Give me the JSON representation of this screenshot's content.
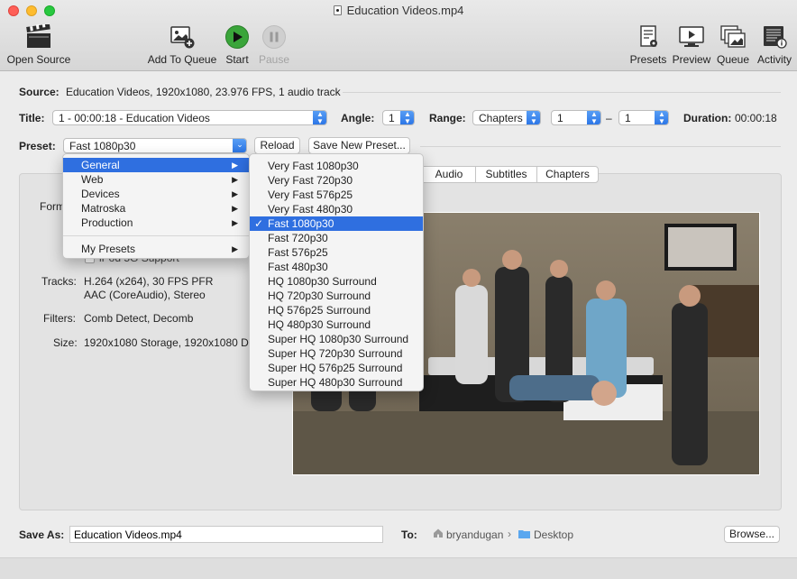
{
  "window": {
    "title": "Education Videos.mp4"
  },
  "toolbar": {
    "open_source": "Open Source",
    "add_to_queue": "Add To Queue",
    "start": "Start",
    "pause": "Pause",
    "presets": "Presets",
    "preview": "Preview",
    "queue": "Queue",
    "activity": "Activity"
  },
  "source": {
    "label": "Source:",
    "value": "Education Videos, 1920x1080, 23.976 FPS, 1 audio track"
  },
  "title_row": {
    "title_label": "Title:",
    "title_value": "1 - 00:00:18 - Education Videos",
    "angle_label": "Angle:",
    "angle_value": "1",
    "range_label": "Range:",
    "range_type": "Chapters",
    "range_start": "1",
    "range_sep": "–",
    "range_end": "1",
    "duration_label": "Duration:",
    "duration_value": "00:00:18"
  },
  "preset_row": {
    "label": "Preset:",
    "value": "Fast 1080p30",
    "reload": "Reload",
    "save_new": "Save New Preset..."
  },
  "tabs": [
    "Audio",
    "Subtitles",
    "Chapters"
  ],
  "summary": {
    "format_label": "Form",
    "ipod_label": "iPod 5G Support",
    "tracks_label": "Tracks:",
    "tracks_line1": "H.264 (x264), 30 FPS PFR",
    "tracks_line2": "AAC (CoreAudio), Stereo",
    "filters_label": "Filters:",
    "filters_value": "Comb Detect, Decomb",
    "size_label": "Size:",
    "size_value": "1920x1080 Storage, 1920x1080 Dis"
  },
  "category_menu": {
    "items": [
      {
        "label": "General",
        "selected": true
      },
      {
        "label": "Web",
        "selected": false
      },
      {
        "label": "Devices",
        "selected": false
      },
      {
        "label": "Matroska",
        "selected": false
      },
      {
        "label": "Production",
        "selected": false
      }
    ],
    "my_presets": "My Presets"
  },
  "preset_menu": {
    "items": [
      "Very Fast 1080p30",
      "Very Fast 720p30",
      "Very Fast 576p25",
      "Very Fast 480p30",
      "Fast 1080p30",
      "Fast 720p30",
      "Fast 576p25",
      "Fast 480p30",
      "HQ 1080p30 Surround",
      "HQ 720p30 Surround",
      "HQ 576p25 Surround",
      "HQ 480p30 Surround",
      "Super HQ 1080p30 Surround",
      "Super HQ 720p30 Surround",
      "Super HQ 576p25 Surround",
      "Super HQ 480p30 Surround"
    ],
    "checked_index": 4,
    "check_mark": "✓"
  },
  "save": {
    "label": "Save As:",
    "value": "Education Videos.mp4",
    "to_label": "To:",
    "path_user": "bryandugan",
    "path_sep": "›",
    "path_folder": "Desktop",
    "browse": "Browse..."
  },
  "colors": {
    "accent": "#2f6fe0",
    "start_green": "#3aa53a"
  }
}
